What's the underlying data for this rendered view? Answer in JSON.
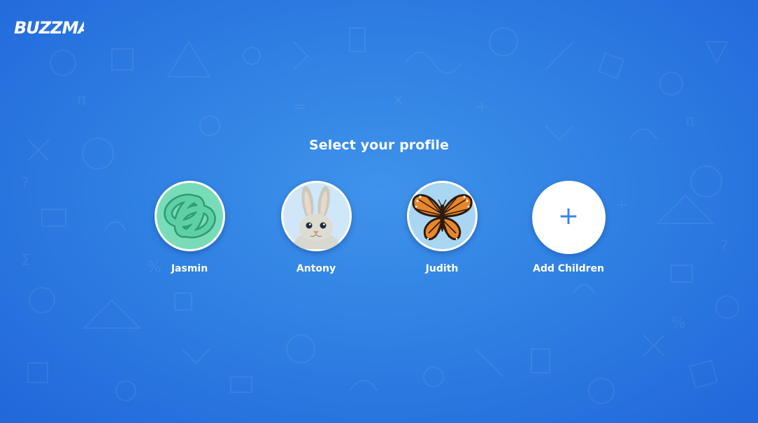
{
  "app": {
    "logo_text": "BUZZMATH"
  },
  "page": {
    "title": "Select your profile"
  },
  "profiles": [
    {
      "name": "Jasmin",
      "avatar": "green-knot"
    },
    {
      "name": "Antony",
      "avatar": "bunny"
    },
    {
      "name": "Judith",
      "avatar": "butterfly"
    }
  ],
  "add_profile": {
    "label": "Add Children",
    "icon": "plus-icon"
  },
  "colors": {
    "background": "#2f80e3",
    "accent": "#3a86e0",
    "text": "#ffffff"
  }
}
